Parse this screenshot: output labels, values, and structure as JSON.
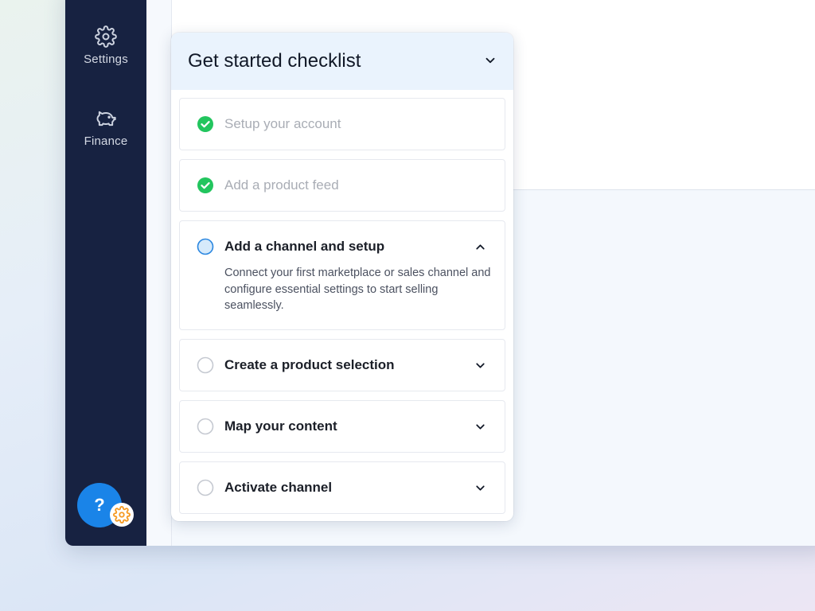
{
  "sidebar": {
    "items": [
      {
        "label": "Settings",
        "icon": "gear-icon"
      },
      {
        "label": "Finance",
        "icon": "piggy-bank-icon"
      }
    ],
    "help_label": "?"
  },
  "checklist": {
    "title": "Get started checklist",
    "tasks": [
      {
        "title": "Setup your account",
        "status": "completed"
      },
      {
        "title": "Add a product feed",
        "status": "completed"
      },
      {
        "title": "Add a channel and setup",
        "status": "active",
        "expanded": true,
        "description": "Connect your first marketplace or sales channel and configure essential settings to start selling seamlessly."
      },
      {
        "title": "Create a product selection",
        "status": "pending"
      },
      {
        "title": "Map your content",
        "status": "pending"
      },
      {
        "title": "Activate channel",
        "status": "pending"
      }
    ]
  },
  "colors": {
    "sidebar_bg": "#172241",
    "accent": "#1a84e8",
    "success": "#22c55e",
    "badge_orange": "#f59a23"
  }
}
